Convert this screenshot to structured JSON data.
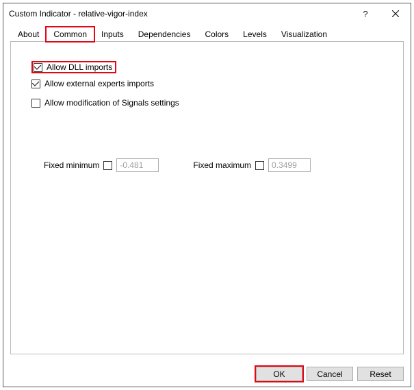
{
  "window": {
    "title": "Custom Indicator - relative-vigor-index"
  },
  "tabs": {
    "items": [
      {
        "label": "About"
      },
      {
        "label": "Common"
      },
      {
        "label": "Inputs"
      },
      {
        "label": "Dependencies"
      },
      {
        "label": "Colors"
      },
      {
        "label": "Levels"
      },
      {
        "label": "Visualization"
      }
    ]
  },
  "options": {
    "allow_dll": {
      "label": "Allow DLL imports",
      "checked": true
    },
    "allow_external": {
      "label": "Allow external experts imports",
      "checked": true
    },
    "allow_signals": {
      "label": "Allow modification of Signals settings",
      "checked": false
    }
  },
  "minmax": {
    "min_label": "Fixed minimum",
    "min_value": "-0.481",
    "max_label": "Fixed maximum",
    "max_value": "0.3499"
  },
  "buttons": {
    "ok": "OK",
    "cancel": "Cancel",
    "reset": "Reset"
  }
}
